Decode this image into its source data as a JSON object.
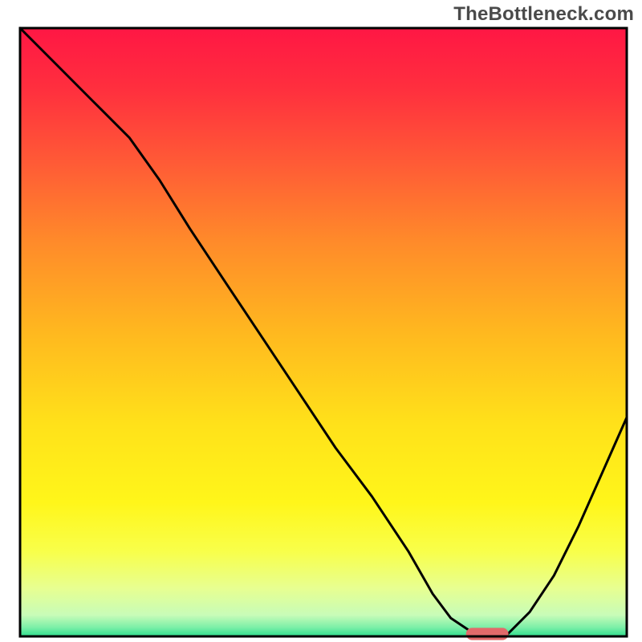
{
  "watermark": "TheBottleneck.com",
  "chart_data": {
    "type": "line",
    "title": "",
    "xlabel": "",
    "ylabel": "",
    "xlim": [
      0,
      100
    ],
    "ylim": [
      0,
      100
    ],
    "background_gradient": {
      "stops": [
        {
          "offset": 0.0,
          "color": "#ff1744"
        },
        {
          "offset": 0.1,
          "color": "#ff2f3e"
        },
        {
          "offset": 0.22,
          "color": "#ff5a36"
        },
        {
          "offset": 0.35,
          "color": "#ff8a2a"
        },
        {
          "offset": 0.5,
          "color": "#ffb81f"
        },
        {
          "offset": 0.65,
          "color": "#ffe11a"
        },
        {
          "offset": 0.78,
          "color": "#fff61a"
        },
        {
          "offset": 0.86,
          "color": "#f8ff4a"
        },
        {
          "offset": 0.92,
          "color": "#e8ff90"
        },
        {
          "offset": 0.965,
          "color": "#c8fcb8"
        },
        {
          "offset": 0.985,
          "color": "#7defa8"
        },
        {
          "offset": 1.0,
          "color": "#2fe08e"
        }
      ]
    },
    "series": [
      {
        "name": "bottleneck-curve",
        "x": [
          0,
          6,
          12,
          18,
          23,
          28,
          34,
          40,
          46,
          52,
          58,
          64,
          68,
          71,
          74,
          78,
          80,
          84,
          88,
          92,
          96,
          100
        ],
        "y": [
          100,
          94,
          88,
          82,
          75,
          67,
          58,
          49,
          40,
          31,
          23,
          14,
          7,
          3,
          1,
          0,
          0,
          4,
          10,
          18,
          27,
          36
        ]
      }
    ],
    "markers": [
      {
        "name": "optimal-zone",
        "shape": "rounded-rect",
        "x_start": 73.5,
        "x_end": 80.5,
        "y": 0,
        "height_pct": 2.0,
        "color": "#e26a6a"
      }
    ],
    "axes": {
      "frame_color": "#000000",
      "frame_stroke_width": 3,
      "show_ticks": false,
      "show_grid": false
    }
  }
}
